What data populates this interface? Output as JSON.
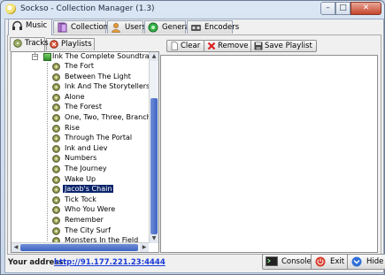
{
  "window": {
    "title": "Sockso - Collection Manager (1.3)",
    "min": "–",
    "max": "□",
    "close": "✕"
  },
  "tabs": [
    {
      "label": "Music",
      "icon": "headphones-icon"
    },
    {
      "label": "Collection",
      "icon": "collection-icon"
    },
    {
      "label": "Users",
      "icon": "users-icon"
    },
    {
      "label": "General",
      "icon": "general-icon"
    },
    {
      "label": "Encoders",
      "icon": "encoders-icon"
    }
  ],
  "subtabs": [
    {
      "label": "Tracks",
      "icon": "tracks-icon"
    },
    {
      "label": "Playlists",
      "icon": "playlists-icon"
    }
  ],
  "tree": {
    "album": "Ink The Complete Soundtrack",
    "tracks": [
      "The Fort",
      "Between The Light",
      "Ink And The Storytellers",
      "Alone",
      "The Forest",
      "One, Two, Three, Branch",
      "Rise",
      "Through The Portal",
      "Ink and Liev",
      "Numbers",
      "The Journey",
      "Wake Up",
      "Jacob's Chain",
      "Tick Tock",
      "Who You Were",
      "Remember",
      "The City Surf",
      "Monsters In the Field"
    ],
    "selected": "Jacob's Chain"
  },
  "playlist_toolbar": {
    "clear": "Clear",
    "remove": "Remove",
    "save": "Save Playlist"
  },
  "footer": {
    "address_label": "Your address:",
    "address": "http://91.177.221.23:4444",
    "console": "Console",
    "exit": "Exit",
    "hide": "Hide"
  },
  "colors": {
    "selection": "#0a246a",
    "link": "#1a3bd6",
    "scroll_thumb": "#3e64c4"
  }
}
